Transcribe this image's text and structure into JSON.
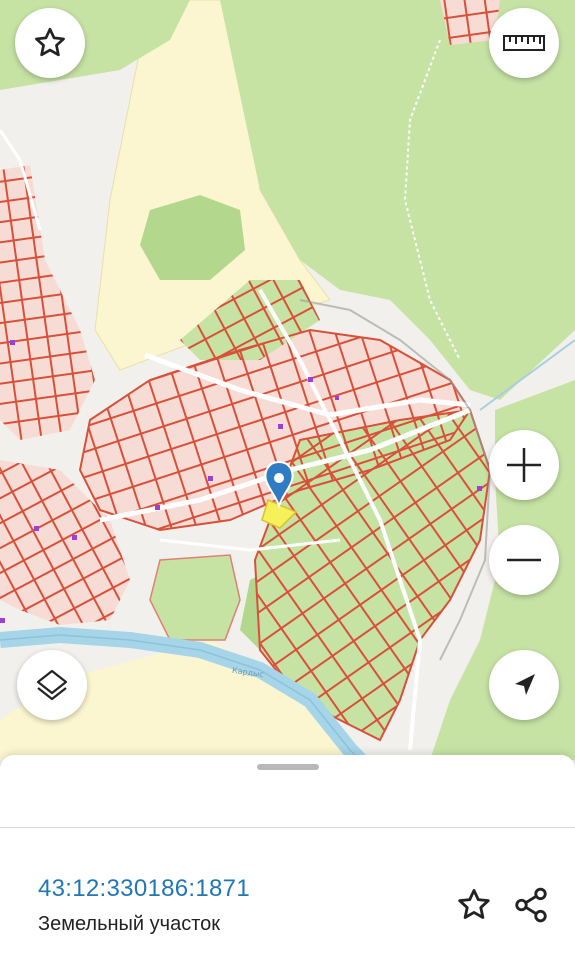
{
  "map": {
    "river_label": "Кардыс",
    "colors": {
      "forest": "#c6e3a4",
      "forest_dark": "#b2d78d",
      "field": "#fbf6cf",
      "settlement": "#f6dcd4",
      "parcel_line": "#d9503a",
      "river": "#a6d4e8",
      "road": "#ffffff",
      "selected": "#f6f05a",
      "marker": "#2f7bc4"
    }
  },
  "controls": {
    "favorite": {
      "icon": "star-outline-icon"
    },
    "ruler": {
      "icon": "ruler-icon"
    },
    "zoom_in": {
      "icon": "plus-icon"
    },
    "zoom_out": {
      "icon": "minus-icon"
    },
    "layers": {
      "icon": "layers-icon"
    },
    "locate": {
      "icon": "navigation-arrow-icon"
    }
  },
  "sheet": {
    "cadastral_number": "43:12:330186:1871",
    "object_type": "Земельный участок",
    "actions": [
      {
        "name": "favorite",
        "icon": "star-outline-icon"
      },
      {
        "name": "share",
        "icon": "share-icon"
      }
    ]
  }
}
